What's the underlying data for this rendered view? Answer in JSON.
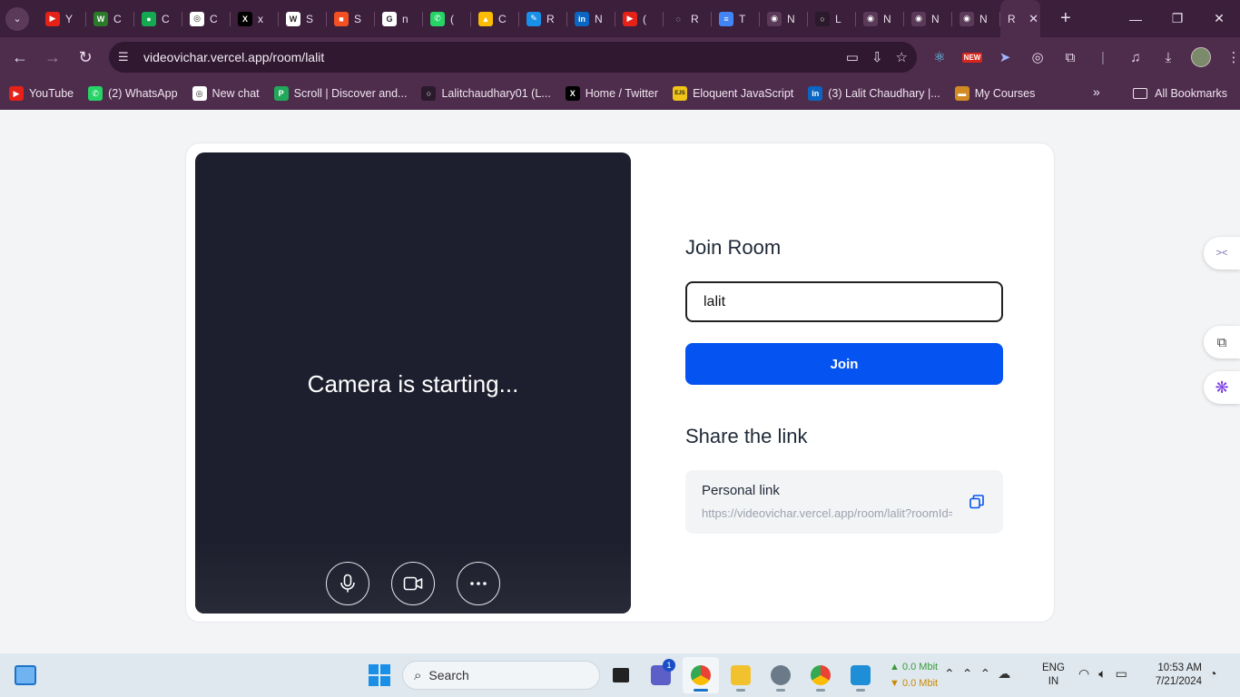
{
  "browser": {
    "tabs": [
      {
        "label": "Y",
        "icon": "youtube-icon",
        "color": "#e62117",
        "glyph": "▶"
      },
      {
        "label": "C",
        "icon": "w-icon",
        "color": "#2a7a2a",
        "glyph": "W"
      },
      {
        "label": "C",
        "icon": "leaf-icon",
        "color": "#13aa52",
        "glyph": "●"
      },
      {
        "label": "C",
        "icon": "chatgpt-icon",
        "color": "#ffffff",
        "glyph": "◎"
      },
      {
        "label": "x",
        "icon": "x-icon",
        "color": "#000000",
        "glyph": "X"
      },
      {
        "label": "S",
        "icon": "w-colon-icon",
        "color": "#ffffff",
        "glyph": "W"
      },
      {
        "label": "S",
        "icon": "microsoft-icon",
        "color": "#f25022",
        "glyph": "■"
      },
      {
        "label": "n",
        "icon": "google-icon",
        "color": "#ffffff",
        "glyph": "G"
      },
      {
        "label": "(",
        "icon": "whatsapp-icon",
        "color": "#25d366",
        "glyph": "✆"
      },
      {
        "label": "C",
        "icon": "drive-icon",
        "color": "#fbbc04",
        "glyph": "▲"
      },
      {
        "label": "R",
        "icon": "edit-icon",
        "color": "#1a8fe8",
        "glyph": "✎"
      },
      {
        "label": "N",
        "icon": "linkedin-icon",
        "color": "#0a66c2",
        "glyph": "in"
      },
      {
        "label": "(",
        "icon": "youtube-icon",
        "color": "#e62117",
        "glyph": "▶"
      },
      {
        "label": "R",
        "icon": "loader-icon",
        "color": "#3b1f3b",
        "glyph": "◌"
      },
      {
        "label": "T",
        "icon": "docs-icon",
        "color": "#4285f4",
        "glyph": "≡"
      },
      {
        "label": "N",
        "icon": "globe-icon",
        "color": "#5a3a58",
        "glyph": "◉"
      },
      {
        "label": "L",
        "icon": "github-icon",
        "color": "#2b1a2b",
        "glyph": "○"
      },
      {
        "label": "N",
        "icon": "globe-icon",
        "color": "#5a3a58",
        "glyph": "◉"
      },
      {
        "label": "N",
        "icon": "globe-icon",
        "color": "#5a3a58",
        "glyph": "◉"
      },
      {
        "label": "N",
        "icon": "globe-icon",
        "color": "#5a3a58",
        "glyph": "◉"
      }
    ],
    "active_tab": {
      "label": "R",
      "close": "✕"
    },
    "new_tab": "+",
    "window_controls": {
      "minimize": "—",
      "maximize": "❐",
      "close": "✕"
    },
    "nav": {
      "back": "←",
      "forward": "→",
      "reload": "↻"
    },
    "url": "videovichar.vercel.app/room/lalit",
    "new_badge": "NEW",
    "bookmarks": [
      {
        "label": "YouTube",
        "icon": "youtube-icon",
        "color": "#e62117",
        "glyph": "▶"
      },
      {
        "label": "(2) WhatsApp",
        "icon": "whatsapp-icon",
        "color": "#25d366",
        "glyph": "✆"
      },
      {
        "label": "New chat",
        "icon": "chatgpt-icon",
        "color": "#ffffff",
        "glyph": "◎"
      },
      {
        "label": "Scroll | Discover and...",
        "icon": "scroll-icon",
        "color": "#21a85a",
        "glyph": "P"
      },
      {
        "label": "Lalitchaudhary01 (L...",
        "icon": "github-icon",
        "color": "#2b1a2b",
        "glyph": "○"
      },
      {
        "label": "Home / Twitter",
        "icon": "x-icon",
        "color": "#000000",
        "glyph": "X"
      },
      {
        "label": "Eloquent JavaScript",
        "icon": "ejs-icon",
        "color": "#f0c419",
        "glyph": "EJS"
      },
      {
        "label": "(3) Lalit Chaudhary |...",
        "icon": "linkedin-icon",
        "color": "#0a66c2",
        "glyph": "in"
      },
      {
        "label": "My Courses",
        "icon": "courses-icon",
        "color": "#d28a22",
        "glyph": "▬"
      }
    ],
    "bookmarks_more": "»",
    "all_bookmarks": "All Bookmarks"
  },
  "page": {
    "video": {
      "status": "Camera is starting..."
    },
    "join": {
      "title": "Join Room",
      "input_value": "lalit",
      "button": "Join"
    },
    "share": {
      "title": "Share the link",
      "link_label": "Personal link",
      "link_url": "https://videovichar.vercel.app/room/lalit?roomId=lalit"
    },
    "accent": "#0554f2"
  },
  "taskbar": {
    "search_placeholder": "Search",
    "teams_badge": "1",
    "net_up": "▲ 0.0 Mbit",
    "net_down": "▼ 0.0 Mbit",
    "lang_line1": "ENG",
    "lang_line2": "IN",
    "time": "10:53 AM",
    "date": "7/21/2024"
  }
}
